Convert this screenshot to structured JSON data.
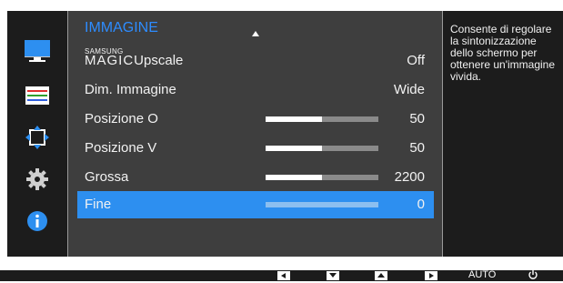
{
  "menu": {
    "title": "IMMAGINE",
    "items": [
      {
        "label_small": "SAMSUNG",
        "label_big": "MAGIC",
        "label_rest": "Upscale",
        "value": "Off"
      },
      {
        "label": "Dim. Immagine",
        "value": "Wide"
      },
      {
        "label": "Posizione O",
        "value": "50",
        "level": 0.5
      },
      {
        "label": "Posizione V",
        "value": "50",
        "level": 0.5
      },
      {
        "label": "Grossa",
        "value": "2200",
        "level": 0.5
      },
      {
        "label": "Fine",
        "value": "0",
        "level": 0.0
      }
    ],
    "selected_index": 5
  },
  "description": "Consente di regolare la sintonizzazione dello schermo per ottenere un'immagine vivida.",
  "sidebar": {
    "icons": [
      "monitor-icon",
      "color-bars-icon",
      "move-arrows-icon",
      "gear-icon",
      "info-icon"
    ]
  },
  "footer": {
    "auto_label": "AUTO",
    "buttons": [
      "left-arrow-icon",
      "down-arrow-icon",
      "up-arrow-icon",
      "right-arrow-icon",
      "power-icon"
    ]
  },
  "colors": {
    "accent": "#2d8ff0",
    "title": "#2d8cff",
    "panel": "#3e3e3e",
    "background": "#1c1c1c"
  }
}
